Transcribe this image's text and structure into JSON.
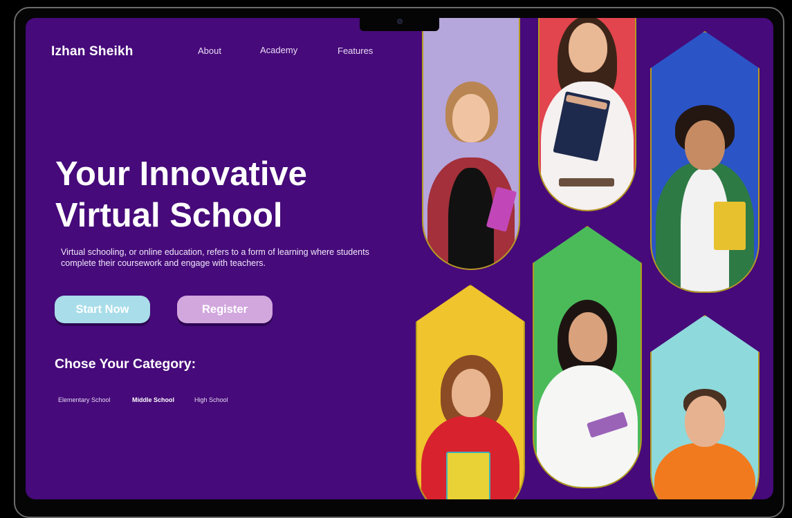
{
  "header": {
    "brand": "Izhan Sheikh",
    "nav": [
      "About",
      "Academy",
      "Features"
    ]
  },
  "hero": {
    "title_line1": "Your Innovative",
    "title_line2": "Virtual School",
    "description": "Virtual schooling, or online education, refers to a form of learning where students complete their coursework and engage with teachers."
  },
  "buttons": {
    "start": "Start Now",
    "register": "Register"
  },
  "categories": {
    "title": "Chose Your Category:",
    "items": [
      "Elementary School",
      "Middle School",
      "High School"
    ],
    "selected": "Middle School"
  },
  "gallery": [
    {
      "name": "student-girl-backpack",
      "bg": "#b5a6dc"
    },
    {
      "name": "student-woman-books",
      "bg": "#e2454d"
    },
    {
      "name": "student-man-curly-hair",
      "bg": "#2b54c7"
    },
    {
      "name": "student-girl-curly-red-hoodie",
      "bg": "#efc42c"
    },
    {
      "name": "student-girl-white-polo",
      "bg": "#4bbb59"
    },
    {
      "name": "student-man-orange-sweater",
      "bg": "#8ed9dc"
    }
  ],
  "colors": {
    "background": "#460a7a",
    "accent_start": "#a9dde9",
    "accent_register": "#d1a7de",
    "tile_border": "#b59a1f"
  }
}
